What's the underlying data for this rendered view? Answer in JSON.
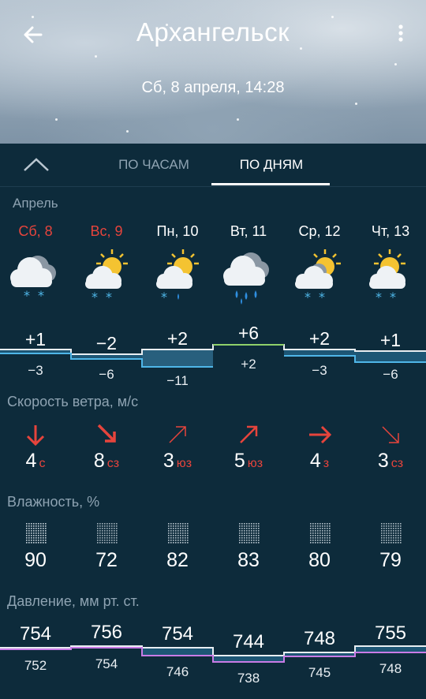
{
  "header": {
    "city": "Архангельск",
    "datetime": "Сб, 8 апреля, 14:28",
    "back_icon": "arrow-left-icon",
    "menu_icon": "more-vertical-icon"
  },
  "tabs": [
    {
      "label": "ПО ЧАСАМ",
      "active": false
    },
    {
      "label": "ПО ДНЯМ",
      "active": true
    }
  ],
  "month": "Апрель",
  "days": [
    {
      "label": "Сб, 8",
      "weekend": true,
      "icon": "cloudy-snow-icon",
      "hi": "+1",
      "lo": "−3"
    },
    {
      "label": "Вс, 9",
      "weekend": true,
      "icon": "partly-sunny-snow-icon",
      "hi": "−2",
      "lo": "−6"
    },
    {
      "label": "Пн, 10",
      "weekend": false,
      "icon": "partly-sunny-sleet-icon",
      "hi": "+2",
      "lo": "−11"
    },
    {
      "label": "Вт, 11",
      "weekend": false,
      "icon": "cloudy-rain-icon",
      "hi": "+6",
      "lo": "+2"
    },
    {
      "label": "Ср, 12",
      "weekend": false,
      "icon": "partly-sunny-snow-icon",
      "hi": "+2",
      "lo": "−3"
    },
    {
      "label": "Чт, 13",
      "weekend": false,
      "icon": "partly-sunny-snow-icon",
      "hi": "+1",
      "lo": "−6"
    }
  ],
  "wind": {
    "title": "Скорость ветра, м/с",
    "items": [
      {
        "speed": "4",
        "dir": "с",
        "icon": "arrow-down-icon"
      },
      {
        "speed": "8",
        "dir": "сз",
        "icon": "arrow-down-right-icon"
      },
      {
        "speed": "3",
        "dir": "юз",
        "icon": "arrow-up-right-icon"
      },
      {
        "speed": "5",
        "dir": "юз",
        "icon": "arrow-up-right-icon"
      },
      {
        "speed": "4",
        "dir": "з",
        "icon": "arrow-right-icon"
      },
      {
        "speed": "3",
        "dir": "сз",
        "icon": "arrow-down-right-icon"
      }
    ]
  },
  "humidity": {
    "title": "Влажность, %",
    "values": [
      "90",
      "72",
      "82",
      "83",
      "80",
      "79"
    ]
  },
  "pressure": {
    "title": "Давление, мм рт. ст.",
    "hi": [
      "754",
      "756",
      "754",
      "744",
      "748",
      "755"
    ],
    "lo": [
      "752",
      "754",
      "746",
      "738",
      "745",
      "748"
    ]
  },
  "colors": {
    "background": "#0d2b3b",
    "weekend_red": "#e6443c",
    "muted_text": "#8ea3b2",
    "temp_cold_line": "#4fb6e8",
    "temp_warm_line": "#8fd16a",
    "pressure_line": "#c97be6"
  }
}
